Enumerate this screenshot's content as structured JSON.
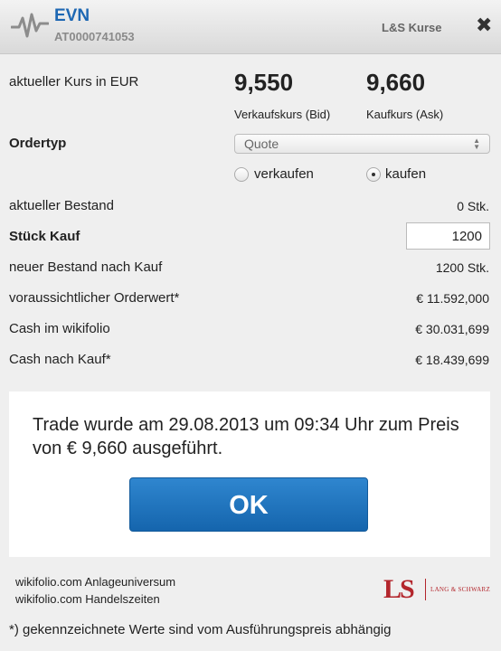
{
  "header": {
    "stock_name": "EVN",
    "isin": "AT0000741053",
    "title": "L&S Kurse",
    "close_glyph": "✖"
  },
  "quote": {
    "label": "aktueller Kurs in EUR",
    "bid_value": "9,550",
    "bid_caption": "Verkaufskurs (Bid)",
    "ask_value": "9,660",
    "ask_caption": "Kaufkurs (Ask)"
  },
  "ordertype": {
    "label": "Ordertyp",
    "selected": "Quote",
    "options": [
      {
        "label": "verkaufen",
        "checked": false
      },
      {
        "label": "kaufen",
        "checked": true
      }
    ]
  },
  "rows": {
    "bestand_label": "aktueller Bestand",
    "bestand_value": "0 Stk.",
    "stueck_label": "Stück Kauf",
    "stueck_value": "1200",
    "neuer_label": "neuer Bestand nach Kauf",
    "neuer_value": "1200 Stk.",
    "orderwert_label": "voraussichtlicher Orderwert*",
    "orderwert_value": "€ 11.592,000",
    "cash_label": "Cash im wikifolio",
    "cash_value": "€ 30.031,699",
    "cash_nach_label": "Cash nach Kauf*",
    "cash_nach_value": "€ 18.439,699"
  },
  "message": {
    "text": "Trade wurde am 29.08.2013 um 09:34 Uhr zum Preis von € 9,660 ausgeführt.",
    "ok_label": "OK"
  },
  "footer": {
    "link1": "wikifolio.com Anlageuniversum",
    "link2": "wikifolio.com Handelszeiten",
    "logo_letters": "LS",
    "logo_brand": "LANG & SCHWARZ",
    "footnote": "*) gekennzeichnete Werte sind vom Ausführungspreis abhängig"
  },
  "colors": {
    "accent": "#1d67b3",
    "button": "#1f74bf",
    "brand_red": "#b3262c"
  }
}
